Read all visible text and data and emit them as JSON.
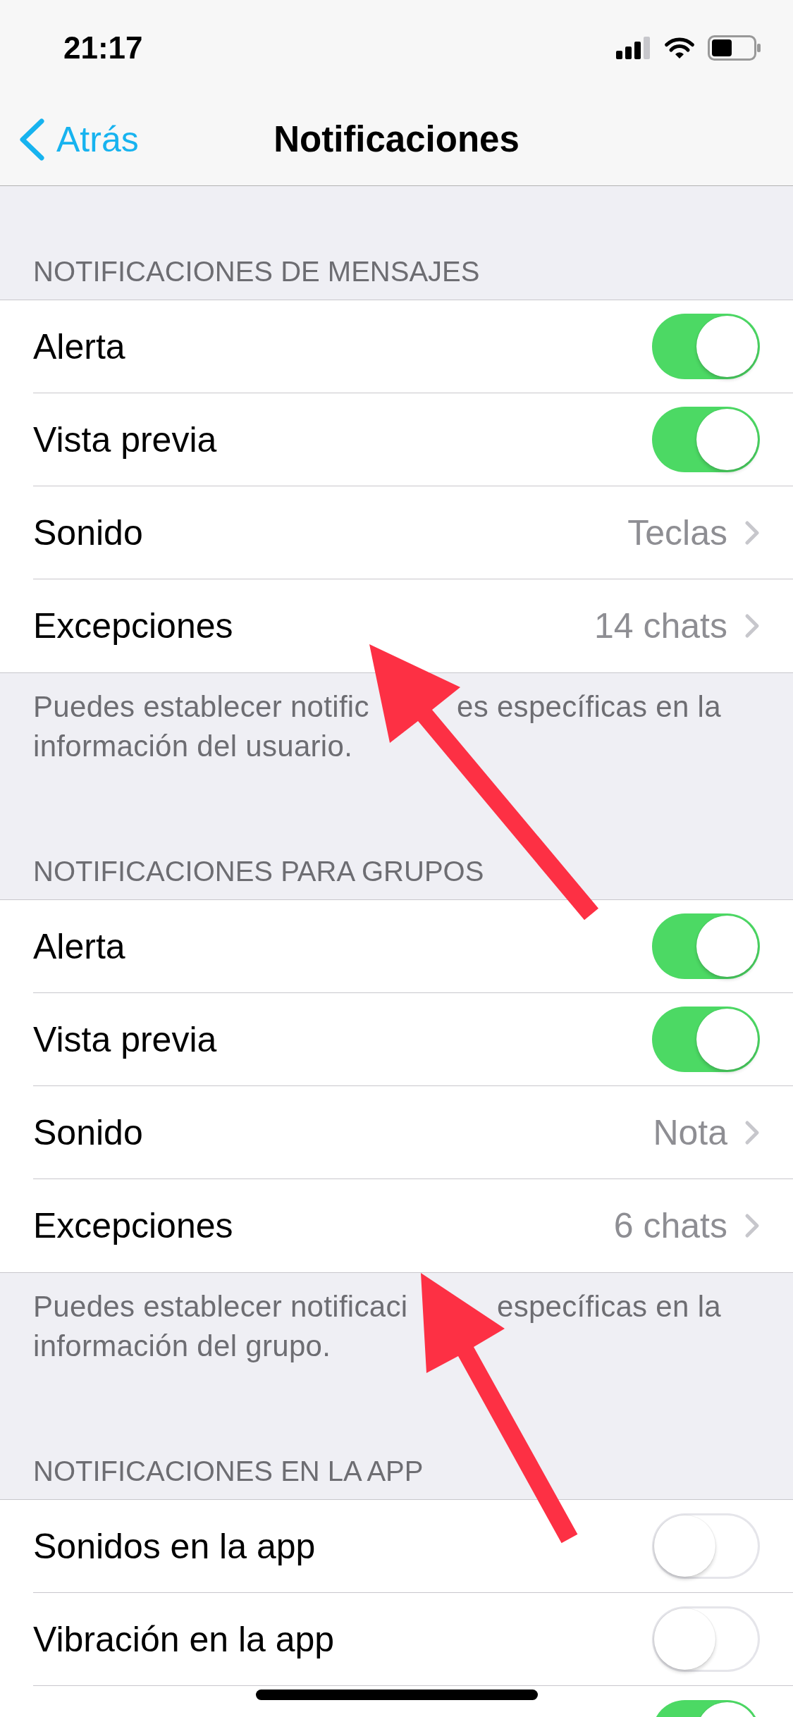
{
  "status_bar": {
    "time": "21:17"
  },
  "nav_bar": {
    "back_label": "Atrás",
    "title": "Notificaciones"
  },
  "sections": [
    {
      "header": "NOTIFICACIONES DE MENSAJES",
      "rows": [
        {
          "kind": "toggle",
          "label": "Alerta",
          "on": true
        },
        {
          "kind": "toggle",
          "label": "Vista previa",
          "on": true
        },
        {
          "kind": "link",
          "label": "Sonido",
          "value": "Teclas"
        },
        {
          "kind": "link",
          "label": "Excepciones",
          "value": "14 chats"
        }
      ],
      "footer_lines": [
        [
          "Puedes establecer notific",
          "es específicas en la"
        ],
        [
          "información del usuario."
        ]
      ]
    },
    {
      "header": "NOTIFICACIONES PARA GRUPOS",
      "rows": [
        {
          "kind": "toggle",
          "label": "Alerta",
          "on": true
        },
        {
          "kind": "toggle",
          "label": "Vista previa",
          "on": true
        },
        {
          "kind": "link",
          "label": "Sonido",
          "value": "Nota"
        },
        {
          "kind": "link",
          "label": "Excepciones",
          "value": "6 chats"
        }
      ],
      "footer_lines": [
        [
          "Puedes establecer notificaci",
          "específicas en la"
        ],
        [
          "información del grupo."
        ]
      ]
    },
    {
      "header": "NOTIFICACIONES EN LA APP",
      "rows": [
        {
          "kind": "toggle",
          "label": "Sonidos en la app",
          "on": false
        },
        {
          "kind": "toggle",
          "label": "Vibración en la app",
          "on": false
        },
        {
          "kind": "toggle",
          "on": true
        }
      ]
    }
  ],
  "annotations": [
    {
      "kind": "arrow"
    },
    {
      "kind": "arrow"
    }
  ]
}
